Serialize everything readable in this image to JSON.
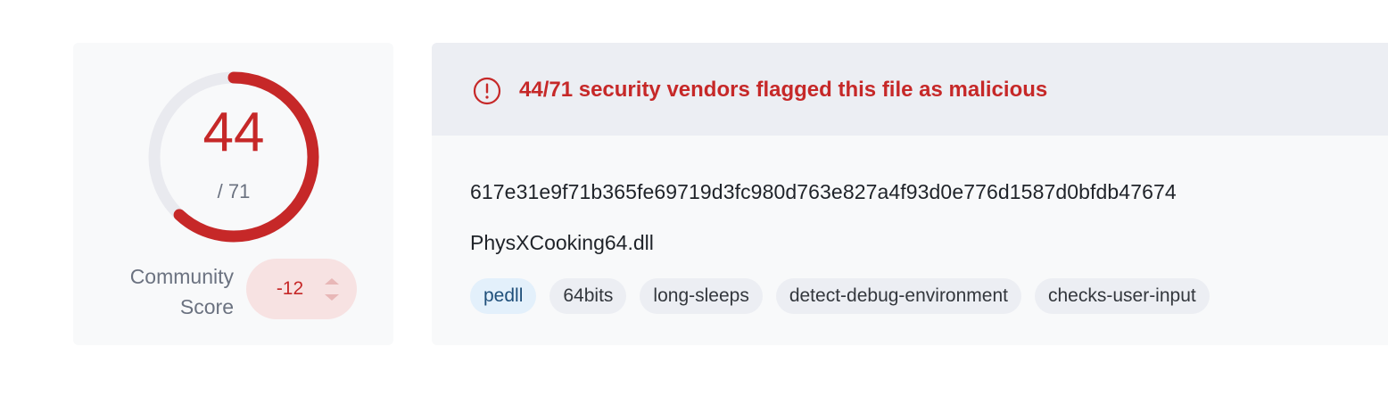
{
  "detection_score": {
    "detections": 44,
    "total": 71,
    "detections_label": "44",
    "total_label": "/ 71",
    "fill_fraction": 0.6197,
    "accent_color": "#c62828",
    "track_color": "#e9eaef"
  },
  "community_score": {
    "label": "Community Score",
    "value": "-12"
  },
  "alert": {
    "icon": "exclamation-circle-icon",
    "text": "44/71 security vendors flagged this file as malicious"
  },
  "file": {
    "hash": "617e31e9f71b365fe69719d3fc980d763e827a4f93d0e776d1587d0bfdb47674",
    "name": "PhysXCooking64.dll"
  },
  "tags": [
    "pedll",
    "64bits",
    "long-sleeps",
    "detect-debug-environment",
    "checks-user-input"
  ]
}
